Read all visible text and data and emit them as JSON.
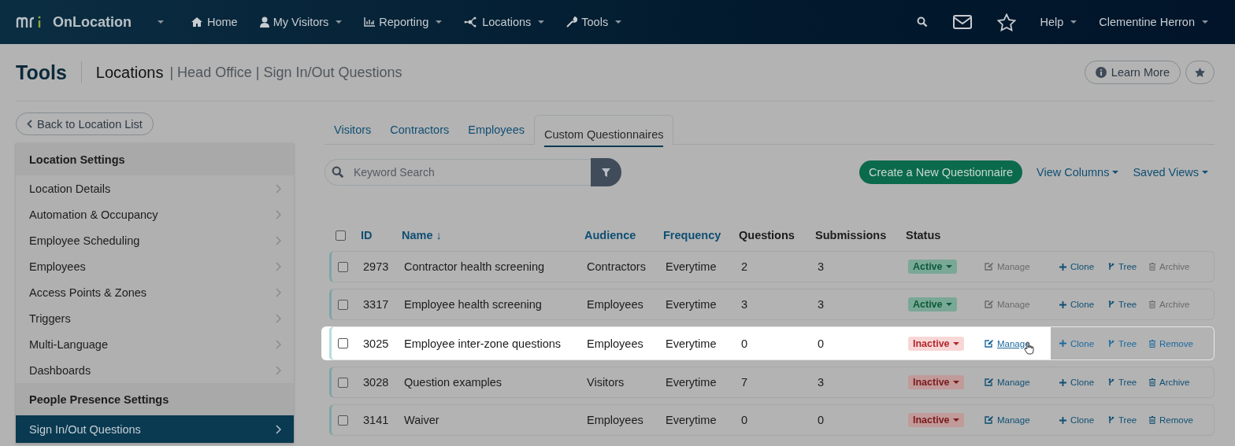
{
  "nav": {
    "brand": "OnLocation",
    "items": [
      {
        "label": "Home",
        "dropdown": false
      },
      {
        "label": "My Visitors",
        "dropdown": true
      },
      {
        "label": "Reporting",
        "dropdown": true
      },
      {
        "label": "Locations",
        "dropdown": true
      },
      {
        "label": "Tools",
        "dropdown": true
      }
    ],
    "help": "Help",
    "user": "Clementine Herron"
  },
  "header": {
    "title": "Tools",
    "section": "Locations",
    "breadcrumb": "| Head Office | Sign In/Out Questions",
    "learn_more": "Learn More"
  },
  "back_button": "Back to Location List",
  "sidebar": {
    "groups": [
      {
        "heading": "Location Settings",
        "items": [
          {
            "label": "Location Details",
            "selected": false
          },
          {
            "label": "Automation & Occupancy",
            "selected": false
          },
          {
            "label": "Employee Scheduling",
            "selected": false
          },
          {
            "label": "Employees",
            "selected": false
          },
          {
            "label": "Access Points & Zones",
            "selected": false
          },
          {
            "label": "Triggers",
            "selected": false
          },
          {
            "label": "Multi-Language",
            "selected": false
          },
          {
            "label": "Dashboards",
            "selected": false
          }
        ]
      },
      {
        "heading": "People Presence Settings",
        "items": [
          {
            "label": "Sign In/Out Questions",
            "selected": true
          }
        ]
      }
    ]
  },
  "tabs": [
    {
      "label": "Visitors",
      "selected": false
    },
    {
      "label": "Contractors",
      "selected": false
    },
    {
      "label": "Employees",
      "selected": false
    },
    {
      "label": "Custom Questionnaires",
      "selected": true
    }
  ],
  "search": {
    "placeholder": "Keyword Search"
  },
  "create_button": "Create a New Questionnaire",
  "view_columns": "View Columns",
  "saved_views": "Saved Views",
  "table": {
    "select_all": {
      "checked": false
    },
    "columns": [
      {
        "label": "ID",
        "sortable": true
      },
      {
        "label": "Name ↓",
        "sortable": true
      },
      {
        "label": "Audience",
        "sortable": true
      },
      {
        "label": "Frequency",
        "sortable": true
      },
      {
        "label": "Questions",
        "sortable": false
      },
      {
        "label": "Submissions",
        "sortable": false
      },
      {
        "label": "Status",
        "sortable": false
      }
    ],
    "rows": [
      {
        "id": "2973",
        "name": "Contractor health screening",
        "audience": "Contractors",
        "frequency": "Everytime",
        "questions": "2",
        "submissions": "3",
        "status": {
          "label": "Active",
          "kind": "active"
        },
        "highlighted": false,
        "actions": [
          {
            "label": "Manage",
            "kind": "manage",
            "disabled": true,
            "hovered": false
          },
          {
            "label": "Clone",
            "kind": "clone",
            "disabled": false,
            "hovered": false
          },
          {
            "label": "Tree",
            "kind": "tree",
            "disabled": false,
            "hovered": false
          },
          {
            "label": "Archive",
            "kind": "delete",
            "disabled": true,
            "hovered": false
          }
        ]
      },
      {
        "id": "3317",
        "name": "Employee health screening",
        "audience": "Employees",
        "frequency": "Everytime",
        "questions": "3",
        "submissions": "3",
        "status": {
          "label": "Active",
          "kind": "active"
        },
        "highlighted": false,
        "actions": [
          {
            "label": "Manage",
            "kind": "manage",
            "disabled": true,
            "hovered": false
          },
          {
            "label": "Clone",
            "kind": "clone",
            "disabled": false,
            "hovered": false
          },
          {
            "label": "Tree",
            "kind": "tree",
            "disabled": false,
            "hovered": false
          },
          {
            "label": "Archive",
            "kind": "delete",
            "disabled": true,
            "hovered": false
          }
        ]
      },
      {
        "id": "3025",
        "name": "Employee inter-zone questions",
        "audience": "Employees",
        "frequency": "Everytime",
        "questions": "0",
        "submissions": "0",
        "status": {
          "label": "Inactive",
          "kind": "inactive"
        },
        "highlighted": true,
        "actions": [
          {
            "label": "Manage",
            "kind": "manage",
            "disabled": false,
            "hovered": true
          },
          {
            "label": "Clone",
            "kind": "clone",
            "disabled": false,
            "hovered": false
          },
          {
            "label": "Tree",
            "kind": "tree",
            "disabled": false,
            "hovered": false
          },
          {
            "label": "Remove",
            "kind": "delete",
            "disabled": false,
            "hovered": false
          }
        ]
      },
      {
        "id": "3028",
        "name": "Question examples",
        "audience": "Visitors",
        "frequency": "Everytime",
        "questions": "7",
        "submissions": "3",
        "status": {
          "label": "Inactive",
          "kind": "inactive"
        },
        "highlighted": false,
        "actions": [
          {
            "label": "Manage",
            "kind": "manage",
            "disabled": false,
            "hovered": false
          },
          {
            "label": "Clone",
            "kind": "clone",
            "disabled": false,
            "hovered": false
          },
          {
            "label": "Tree",
            "kind": "tree",
            "disabled": false,
            "hovered": false
          },
          {
            "label": "Archive",
            "kind": "delete",
            "disabled": false,
            "hovered": false
          }
        ]
      },
      {
        "id": "3141",
        "name": "Waiver",
        "audience": "Employees",
        "frequency": "Everytime",
        "questions": "0",
        "submissions": "0",
        "status": {
          "label": "Inactive",
          "kind": "inactive"
        },
        "highlighted": false,
        "actions": [
          {
            "label": "Manage",
            "kind": "manage",
            "disabled": false,
            "hovered": false
          },
          {
            "label": "Clone",
            "kind": "clone",
            "disabled": false,
            "hovered": false
          },
          {
            "label": "Tree",
            "kind": "tree",
            "disabled": false,
            "hovered": false
          },
          {
            "label": "Remove",
            "kind": "delete",
            "disabled": false,
            "hovered": false
          }
        ]
      }
    ]
  }
}
